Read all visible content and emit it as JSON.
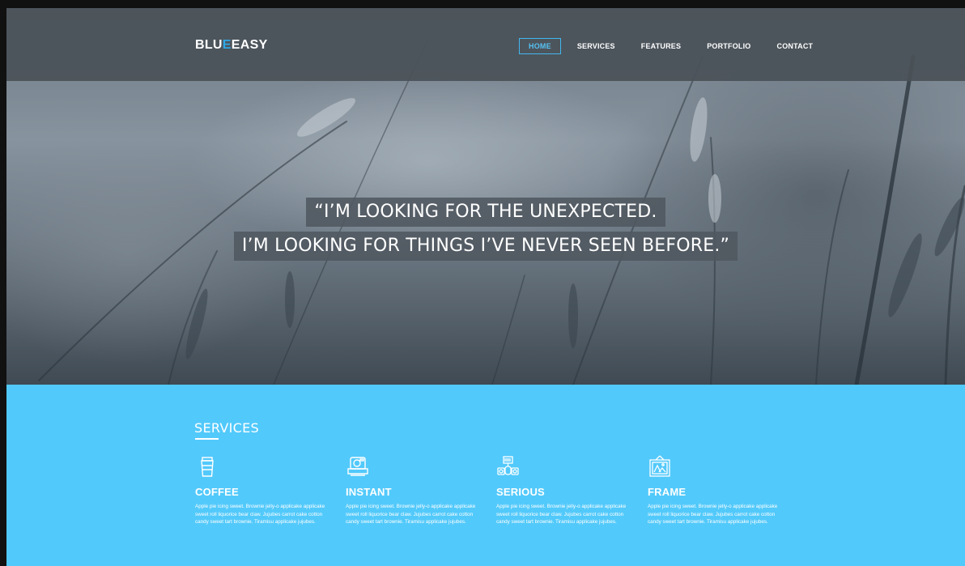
{
  "brand": {
    "part1": "BLU",
    "accent": "E",
    "part2": "EASY",
    "accent_color": "#2ea8e6"
  },
  "nav": {
    "items": [
      {
        "label": "HOME",
        "active": true
      },
      {
        "label": "SERVICES",
        "active": false
      },
      {
        "label": "FEATURES",
        "active": false
      },
      {
        "label": "PORTFOLIO",
        "active": false
      },
      {
        "label": "CONTACT",
        "active": false
      }
    ]
  },
  "hero": {
    "quote_line1": "“I’M LOOKING FOR THE UNEXPECTED.",
    "quote_line2": "I’M LOOKING FOR THINGS I’VE NEVER SEEN BEFORE.”"
  },
  "services": {
    "title": "SERVICES",
    "background_color": "#52c9fb",
    "items": [
      {
        "icon": "coffee-cup-icon",
        "name": "COFFEE",
        "desc": "Apple pie icing sweet. Brownie jelly-o applicake applicake sweet roll liquorice bear claw. Jujubes carrot cake cotton candy sweet tart brownie. Tiramisu applicake jujubes."
      },
      {
        "icon": "camera-icon",
        "name": "INSTANT",
        "desc": "Apple pie icing sweet. Brownie jelly-o applicake applicake sweet roll liquorice bear claw. Jujubes carrot cake cotton candy sweet tart brownie. Tiramisu applicake jujubes."
      },
      {
        "icon": "robot-icon",
        "name": "SERIOUS",
        "desc": "Apple pie icing sweet. Brownie jelly-o applicake applicake sweet roll liquorice bear claw. Jujubes carrot cake cotton candy sweet tart brownie. Tiramisu applicake jujubes."
      },
      {
        "icon": "picture-frame-icon",
        "name": "FRAME",
        "desc": "Apple pie icing sweet. Brownie jelly-o applicake applicake sweet roll liquorice bear claw. Jujubes carrot cake cotton candy sweet tart brownie. Tiramisu applicake jujubes."
      }
    ]
  }
}
